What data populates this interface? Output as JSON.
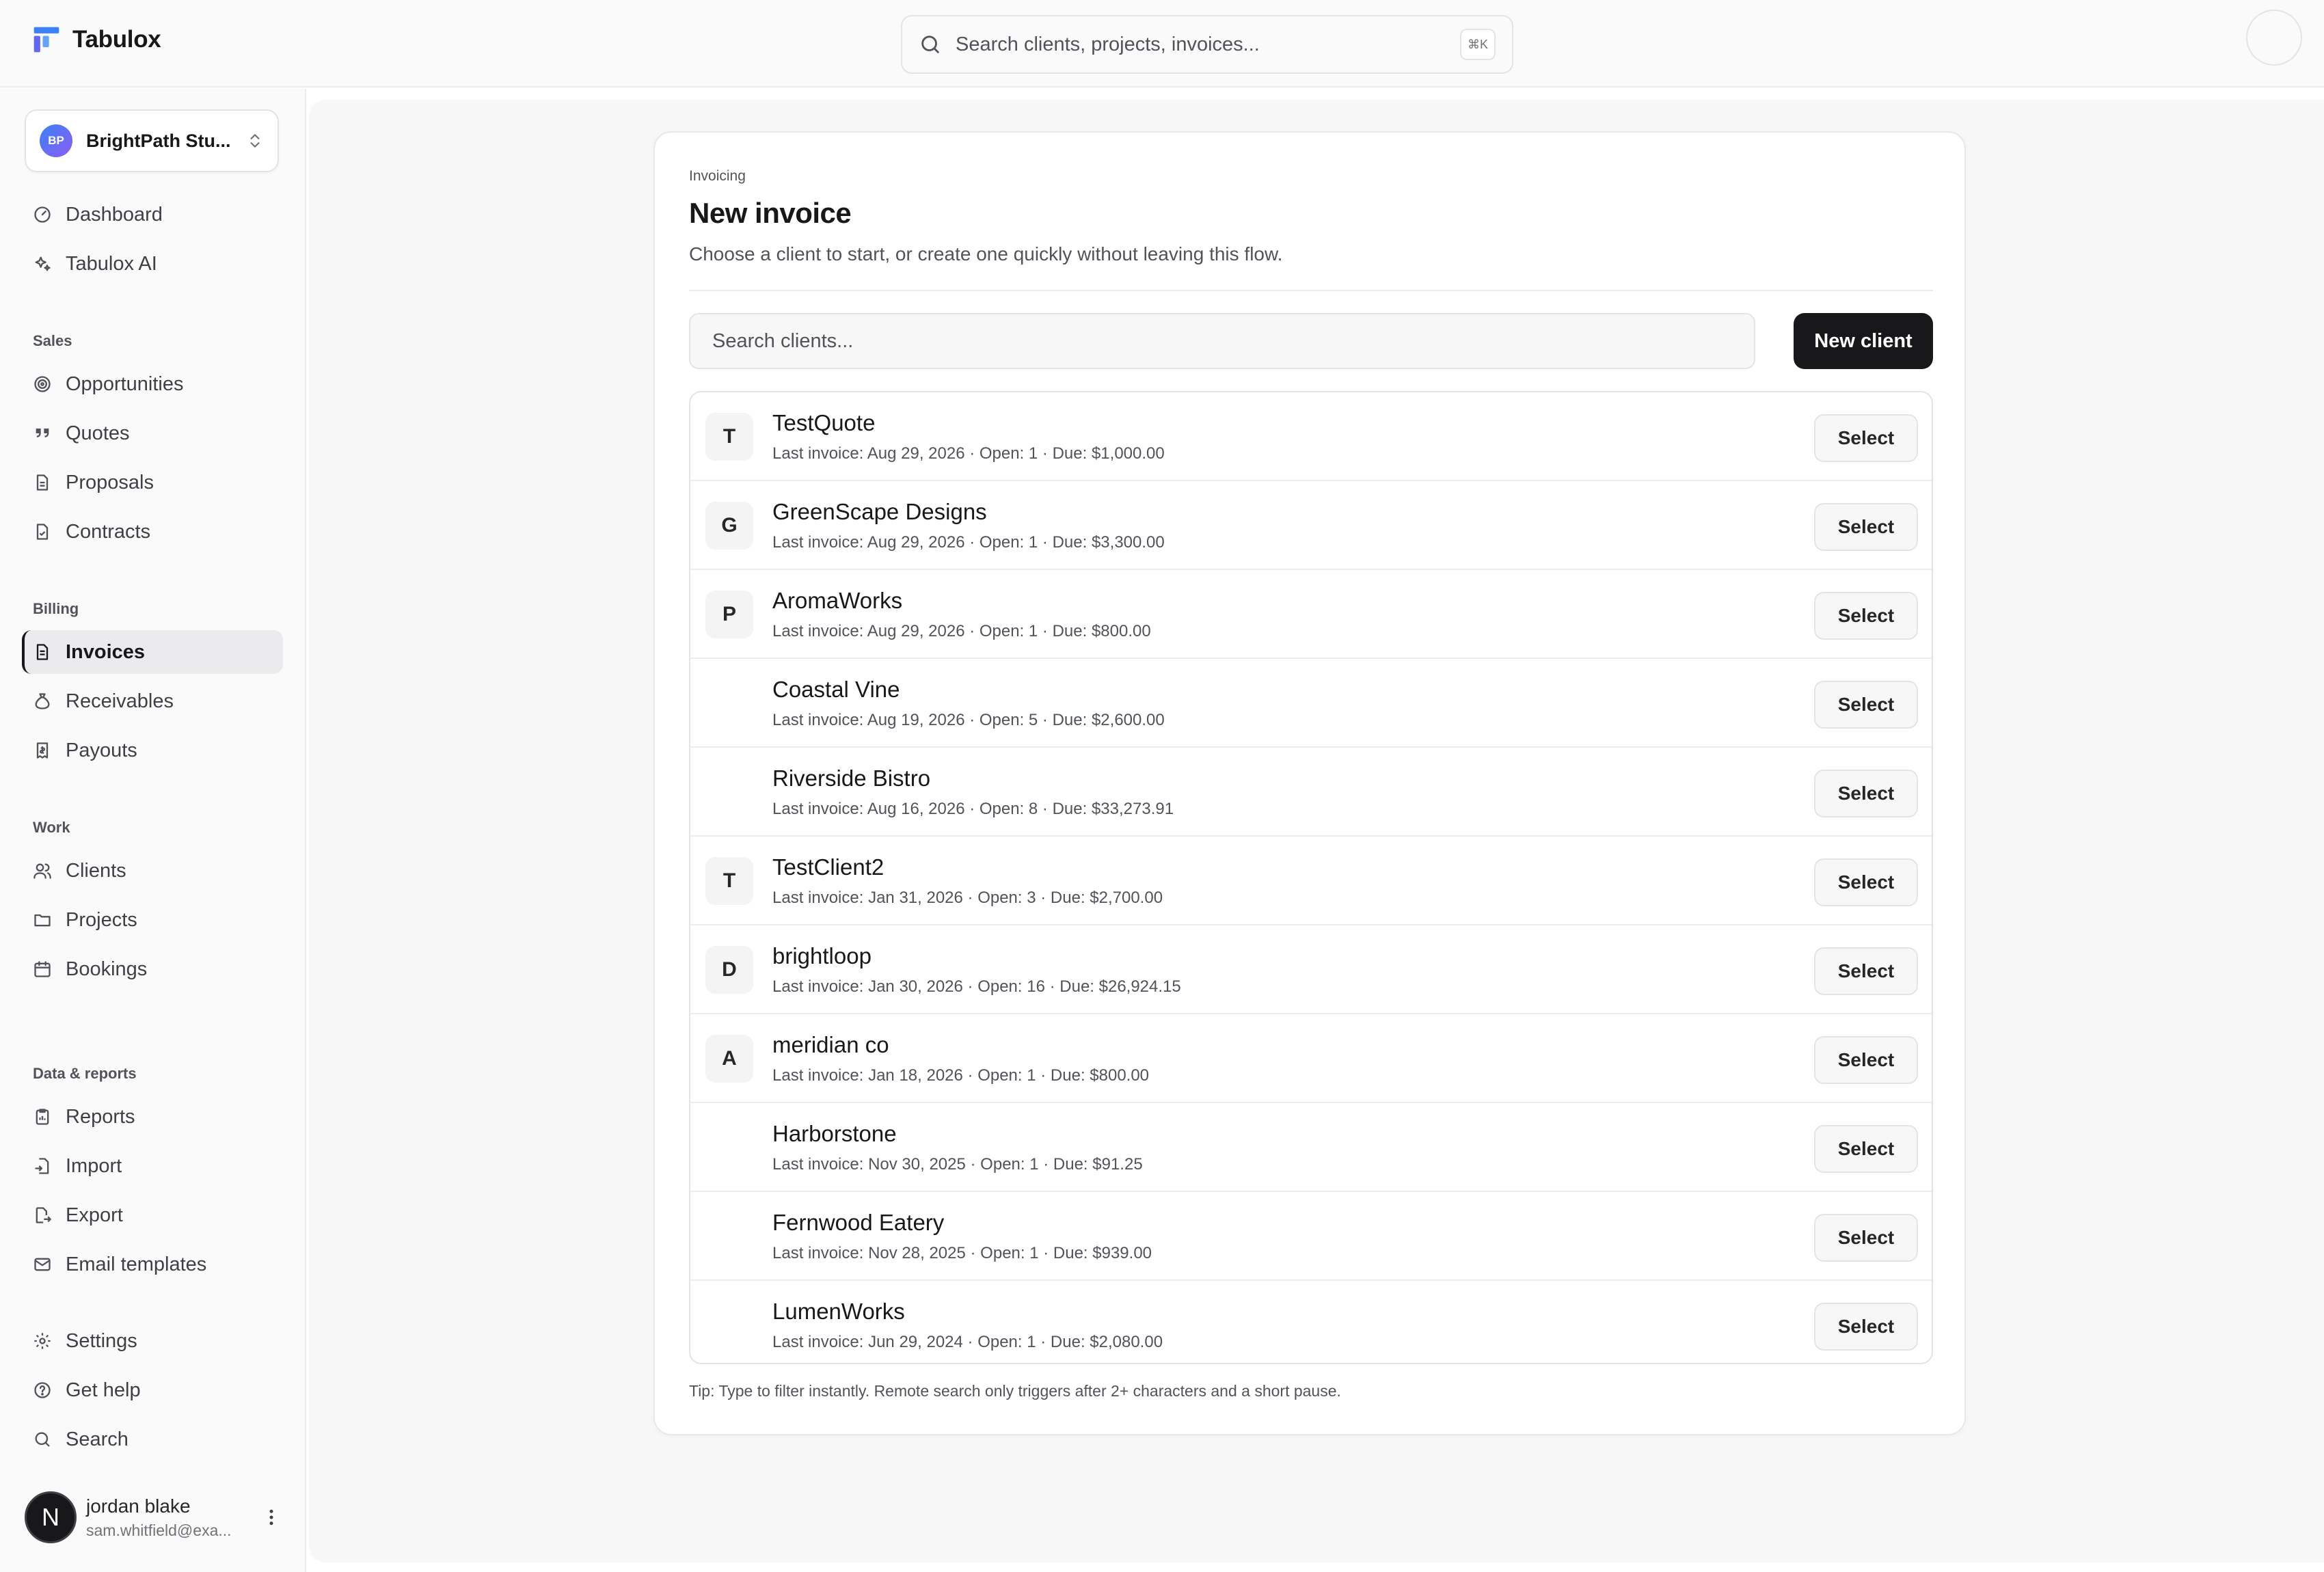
{
  "app": {
    "name": "Tabulox",
    "logo_icon": "tabulox-logo-icon",
    "accent": "#3b82f6"
  },
  "topbar": {
    "search_placeholder": "Search clients, projects, invoices...",
    "shortcut": "⌘K"
  },
  "workspace": {
    "initials": "BP",
    "name": "BrightPath Stu..."
  },
  "nav": {
    "dashboard": "Dashboard",
    "ai": "Tabulox AI",
    "sales_label": "Sales",
    "opportunities": "Opportunities",
    "quotes": "Quotes",
    "proposals": "Proposals",
    "contracts": "Contracts",
    "billing_label": "Billing",
    "invoices": "Invoices",
    "receivables": "Receivables",
    "payouts": "Payouts",
    "work_label": "Work",
    "clients": "Clients",
    "projects": "Projects",
    "bookings": "Bookings",
    "data_label": "Data & reports",
    "reports": "Reports",
    "import": "Import",
    "export": "Export",
    "email_templates": "Email templates",
    "settings": "Settings",
    "help": "Get help",
    "search": "Search",
    "active_item": "Invoices"
  },
  "user": {
    "avatar_letter": "N",
    "name": "jordan blake",
    "email": "sam.whitfield@exa..."
  },
  "page": {
    "eyebrow": "Invoicing",
    "title": "New invoice",
    "subtitle": "Choose a client to start, or create one quickly without leaving this flow.",
    "search_placeholder": "Search clients...",
    "new_client_label": "New client",
    "select_label": "Select",
    "tip": "Tip: Type to filter instantly. Remote search only triggers after 2+ characters and a short pause."
  },
  "clients": [
    {
      "initial": "T",
      "name": "TestQuote",
      "meta": "Last invoice: Aug 29, 2026 · Open: 1 · Due: $1,000.00"
    },
    {
      "initial": "G",
      "name": "GreenScape Designs",
      "meta": "Last invoice: Aug 29, 2026 · Open: 1 · Due: $3,300.00"
    },
    {
      "initial": "P",
      "name": "AromaWorks",
      "meta": "Last invoice: Aug 29, 2026 · Open: 1 · Due: $800.00"
    },
    {
      "initial": "",
      "name": "Coastal Vine",
      "meta": "Last invoice: Aug 19, 2026 · Open: 5 · Due: $2,600.00"
    },
    {
      "initial": "",
      "name": "Riverside Bistro",
      "meta": "Last invoice: Aug 16, 2026 · Open: 8 · Due: $33,273.91"
    },
    {
      "initial": "T",
      "name": "TestClient2",
      "meta": "Last invoice: Jan 31, 2026 · Open: 3 · Due: $2,700.00"
    },
    {
      "initial": "D",
      "name": "brightloop",
      "meta": "Last invoice: Jan 30, 2026 · Open: 16 · Due: $26,924.15"
    },
    {
      "initial": "A",
      "name": "meridian co",
      "meta": "Last invoice: Jan 18, 2026 · Open: 1 · Due: $800.00"
    },
    {
      "initial": "",
      "name": "Harborstone",
      "meta": "Last invoice: Nov 30, 2025 · Open: 1 · Due: $91.25"
    },
    {
      "initial": "",
      "name": "Fernwood Eatery",
      "meta": "Last invoice: Nov 28, 2025 · Open: 1 · Due: $939.00"
    },
    {
      "initial": "",
      "name": "LumenWorks",
      "meta": "Last invoice: Jun 29, 2024 · Open: 1 · Due: $2,080.00"
    }
  ]
}
